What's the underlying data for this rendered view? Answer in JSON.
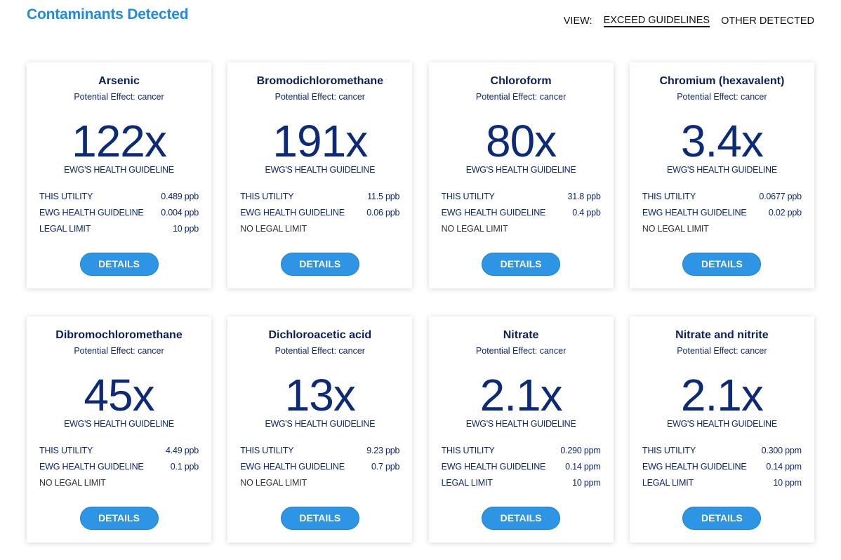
{
  "header": {
    "title": "Contaminants Detected",
    "view_label": "VIEW:",
    "view_options": [
      {
        "label": "EXCEED GUIDELINES",
        "active": true
      },
      {
        "label": "OTHER DETECTED",
        "active": false
      }
    ]
  },
  "colors": {
    "title": "#1f8be0",
    "text_navy": "#0d2670",
    "button": "#2d95e3"
  },
  "cards": [
    {
      "name": "Arsenic",
      "effect": "Potential Effect: cancer",
      "multiple": "122x",
      "guideline_label": "EWG'S HEALTH GUIDELINE",
      "rows": [
        {
          "label": "THIS UTILITY",
          "value": "0.489 ppb"
        },
        {
          "label": "EWG HEALTH GUIDELINE",
          "value": "0.004 ppb"
        },
        {
          "label": "LEGAL LIMIT",
          "value": "10 ppb"
        }
      ],
      "button": "DETAILS"
    },
    {
      "name": "Bromodichloromethane",
      "effect": "Potential Effect: cancer",
      "multiple": "191x",
      "guideline_label": "EWG'S HEALTH GUIDELINE",
      "rows": [
        {
          "label": "THIS UTILITY",
          "value": "11.5 ppb"
        },
        {
          "label": "EWG HEALTH GUIDELINE",
          "value": "0.06 ppb"
        },
        {
          "label": "NO LEGAL LIMIT",
          "value": ""
        }
      ],
      "button": "DETAILS"
    },
    {
      "name": "Chloroform",
      "effect": "Potential Effect: cancer",
      "multiple": "80x",
      "guideline_label": "EWG'S HEALTH GUIDELINE",
      "rows": [
        {
          "label": "THIS UTILITY",
          "value": "31.8 ppb"
        },
        {
          "label": "EWG HEALTH GUIDELINE",
          "value": "0.4 ppb"
        },
        {
          "label": "NO LEGAL LIMIT",
          "value": ""
        }
      ],
      "button": "DETAILS"
    },
    {
      "name": "Chromium (hexavalent)",
      "effect": "Potential Effect: cancer",
      "multiple": "3.4x",
      "guideline_label": "EWG'S HEALTH GUIDELINE",
      "rows": [
        {
          "label": "THIS UTILITY",
          "value": "0.0677 ppb"
        },
        {
          "label": "EWG HEALTH GUIDELINE",
          "value": "0.02 ppb"
        },
        {
          "label": "NO LEGAL LIMIT",
          "value": ""
        }
      ],
      "button": "DETAILS"
    },
    {
      "name": "Dibromochloromethane",
      "effect": "Potential Effect: cancer",
      "multiple": "45x",
      "guideline_label": "EWG'S HEALTH GUIDELINE",
      "rows": [
        {
          "label": "THIS UTILITY",
          "value": "4.49 ppb"
        },
        {
          "label": "EWG HEALTH GUIDELINE",
          "value": "0.1 ppb"
        },
        {
          "label": "NO LEGAL LIMIT",
          "value": ""
        }
      ],
      "button": "DETAILS"
    },
    {
      "name": "Dichloroacetic acid",
      "effect": "Potential Effect: cancer",
      "multiple": "13x",
      "guideline_label": "EWG'S HEALTH GUIDELINE",
      "rows": [
        {
          "label": "THIS UTILITY",
          "value": "9.23 ppb"
        },
        {
          "label": "EWG HEALTH GUIDELINE",
          "value": "0.7 ppb"
        },
        {
          "label": "NO LEGAL LIMIT",
          "value": ""
        }
      ],
      "button": "DETAILS"
    },
    {
      "name": "Nitrate",
      "effect": "Potential Effect: cancer",
      "multiple": "2.1x",
      "guideline_label": "EWG'S HEALTH GUIDELINE",
      "rows": [
        {
          "label": "THIS UTILITY",
          "value": "0.290 ppm"
        },
        {
          "label": "EWG HEALTH GUIDELINE",
          "value": "0.14 ppm"
        },
        {
          "label": "LEGAL LIMIT",
          "value": "10 ppm"
        }
      ],
      "button": "DETAILS"
    },
    {
      "name": "Nitrate and nitrite",
      "effect": "Potential Effect: cancer",
      "multiple": "2.1x",
      "guideline_label": "EWG'S HEALTH GUIDELINE",
      "rows": [
        {
          "label": "THIS UTILITY",
          "value": "0.300 ppm"
        },
        {
          "label": "EWG HEALTH GUIDELINE",
          "value": "0.14 ppm"
        },
        {
          "label": "LEGAL LIMIT",
          "value": "10 ppm"
        }
      ],
      "button": "DETAILS"
    }
  ]
}
